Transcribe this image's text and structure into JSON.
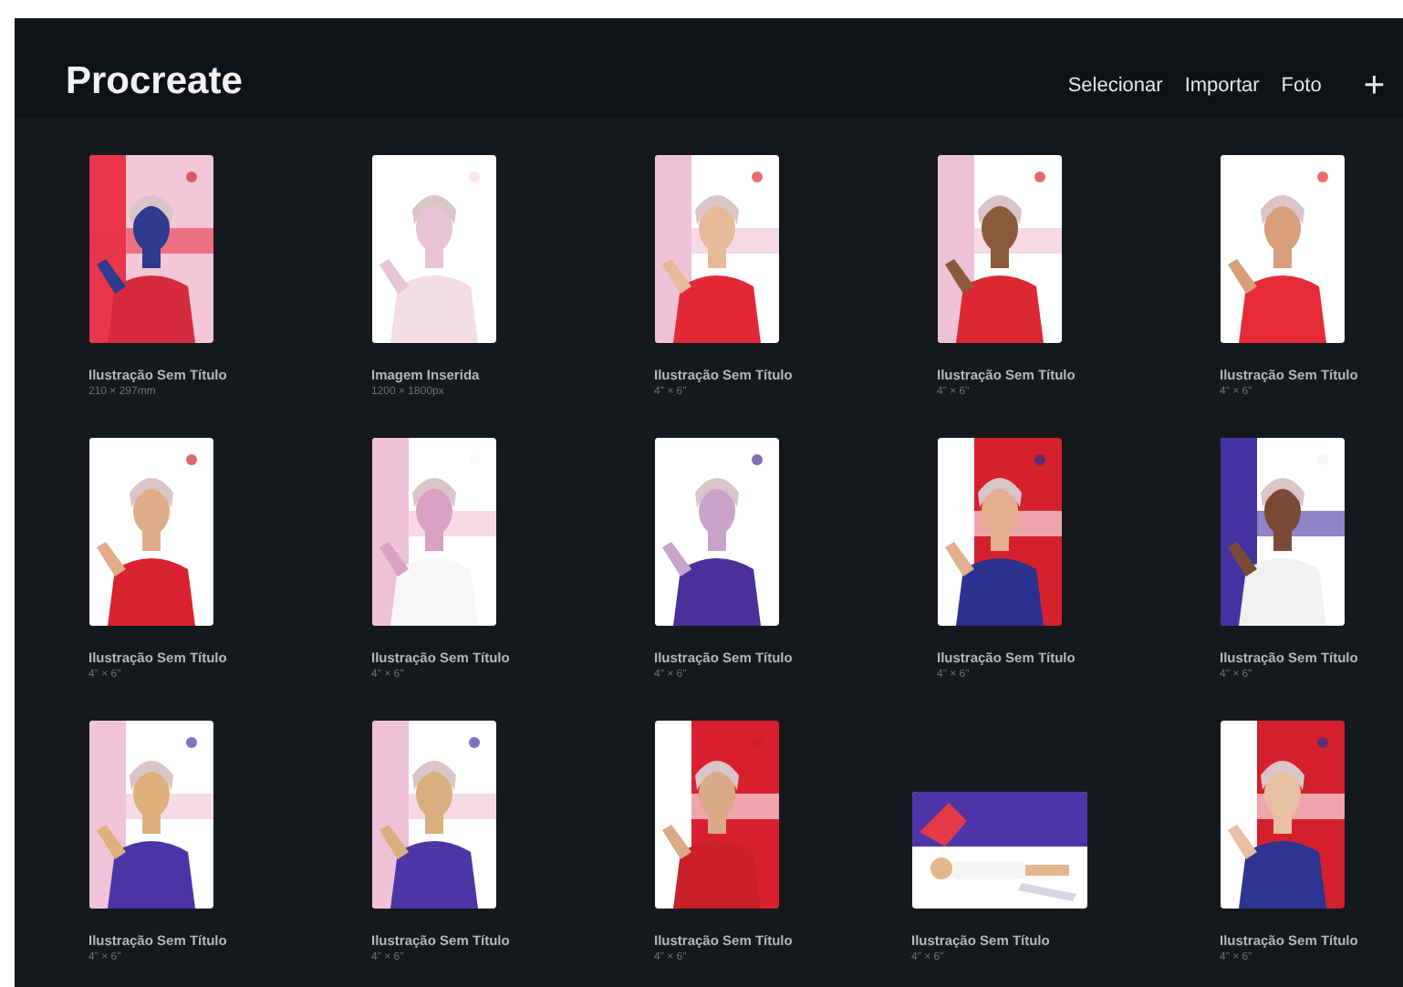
{
  "app": {
    "title": "Procreate",
    "actions": [
      "Selecionar",
      "Importar",
      "Foto"
    ],
    "add_button": "+"
  },
  "artworks": [
    {
      "kind": "portrait",
      "title": "Ilustração Sem Título",
      "size": "210 × 297mm"
    },
    {
      "kind": "portrait",
      "title": "Imagem Inserida",
      "size": "1200 × 1800px"
    },
    {
      "kind": "portrait",
      "title": "Ilustração Sem Título",
      "size": "4\" × 6\""
    },
    {
      "kind": "portrait",
      "title": "Ilustração Sem Título",
      "size": "4\" × 6\""
    },
    {
      "kind": "portrait",
      "title": "Ilustração Sem Título",
      "size": "4\" × 6\""
    },
    {
      "kind": "portrait",
      "title": "Ilustração Sem Título",
      "size": "4\" × 6\""
    },
    {
      "kind": "portrait",
      "title": "Ilustração Sem Título",
      "size": "4\" × 6\""
    },
    {
      "kind": "portrait",
      "title": "Ilustração Sem Título",
      "size": "4\" × 6\""
    },
    {
      "kind": "portrait",
      "title": "Ilustração Sem Título",
      "size": "4\" × 6\""
    },
    {
      "kind": "portrait",
      "title": "Ilustração Sem Título",
      "size": "4\" × 6\""
    },
    {
      "kind": "portrait",
      "title": "Ilustração Sem Título",
      "size": "4\" × 6\""
    },
    {
      "kind": "portrait",
      "title": "Ilustração Sem Título",
      "size": "4\" × 6\""
    },
    {
      "kind": "portrait",
      "title": "Ilustração Sem Título",
      "size": "4\" × 6\""
    },
    {
      "kind": "landscape",
      "title": "Ilustração Sem Título",
      "size": "4\" × 6\""
    },
    {
      "kind": "portrait",
      "title": "Ilustração Sem Título",
      "size": "4\" × 6\""
    }
  ]
}
